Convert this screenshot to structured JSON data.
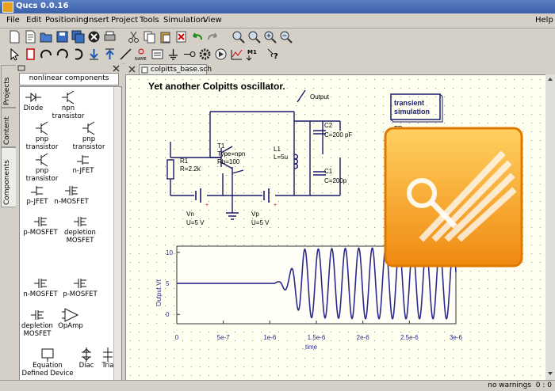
{
  "window": {
    "title": "Qucs 0.0.16"
  },
  "menu": {
    "file": "File",
    "edit": "Edit",
    "positioning": "Positioning",
    "insert": "Insert",
    "project": "Project",
    "tools": "Tools",
    "simulation": "Simulation",
    "view": "View",
    "help": "Help"
  },
  "sidebar_tabs": {
    "projects": "Projects",
    "content": "Content",
    "components": "Components"
  },
  "component_panel": {
    "category": "nonlinear components",
    "items": [
      "Diode",
      "npn transistor",
      "pnp transistor",
      "pnp transistor",
      "pnp transistor",
      "n-JFET",
      "p-JFET",
      "n-MOSFET",
      "p-MOSFET",
      "depletion MOSFET",
      "n-MOSFET",
      "p-MOSFET",
      "depletion MOSFET",
      "OpAmp",
      "Equation Defined Device",
      "Diac",
      "Tria"
    ]
  },
  "document_tab": "colpitts_base.sch",
  "schematic": {
    "title": "Yet another Colpitts oscillator.",
    "output_label": "Output",
    "sim_box": "transient simulation",
    "sim_tr": "TR",
    "r1": [
      "R1",
      "R=2.2k"
    ],
    "t1": [
      "T1",
      "Type=npn",
      "Rb=100"
    ],
    "l1": [
      "L1",
      "L=5u"
    ],
    "c2": [
      "C2",
      "C=200 pF"
    ],
    "c1": [
      "C1",
      "C=200p"
    ],
    "vn": [
      "Vn",
      "U=5 V"
    ],
    "vp": [
      "Vp",
      "U=5 V"
    ]
  },
  "plot": {
    "ylabel": "Output.Vt",
    "xlabel": "time",
    "yticks": [
      "10",
      "5",
      "0"
    ],
    "xticks": [
      "0",
      "5e-7",
      "1e-6",
      "1.5e-6",
      "2e-6",
      "2.5e-6",
      "3e-6"
    ]
  },
  "chart_data": {
    "type": "line",
    "title": "",
    "xlabel": "time",
    "ylabel": "Output.Vt",
    "xlim": [
      0,
      3e-06
    ],
    "ylim": [
      -1.5,
      11
    ],
    "series": [
      {
        "x": [
          0,
          1e-06,
          1.1e-06,
          1.2e-06,
          1.35e-06,
          2e-06,
          3e-06
        ],
        "y": [
          5,
          5,
          5.3,
          6.5,
          10.5,
          10.7,
          10.7
        ]
      }
    ],
    "oscillation": {
      "start": 1.05e-06,
      "period": 1.45e-07,
      "center": 5
    }
  },
  "status": {
    "warnings": "no warnings",
    "coords": "0 : 0"
  },
  "colors": {
    "accent": "#3a5fa8",
    "canvas": "#fffff0",
    "wire": "#1a1a6e",
    "trace": "#2a2a8c",
    "logo": "#f5a623"
  }
}
